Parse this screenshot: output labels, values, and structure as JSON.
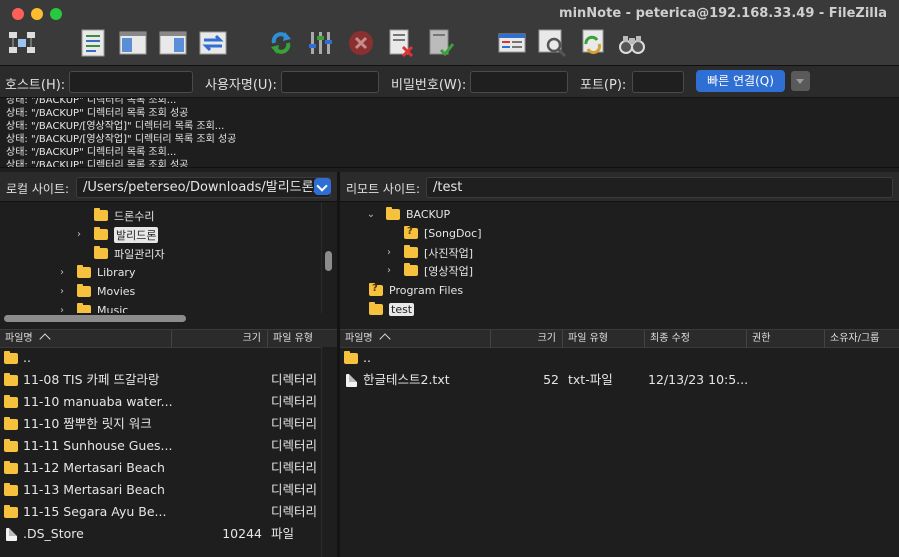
{
  "window": {
    "title": "minNote - peterica@192.168.33.49 - FileZilla"
  },
  "toolbar": {
    "icons": [
      "site-manager-icon",
      "toggle-log-icon",
      "toggle-local-tree-icon",
      "toggle-remote-tree-icon",
      "transfer-queue-icon",
      "refresh-icon",
      "process-queue-icon",
      "cancel-icon",
      "disconnect-icon",
      "reconnect-icon",
      "filter-icon",
      "search-remote-icon",
      "sync-browse-icon",
      "find-files-icon"
    ]
  },
  "quickconnect": {
    "host_label": "호스트(H):",
    "user_label": "사용자명(U):",
    "pass_label": "비밀번호(W):",
    "port_label": "포트(P):",
    "connect_label": "빠른 연결(Q)",
    "host_value": "",
    "user_value": "",
    "pass_value": "",
    "port_value": ""
  },
  "log": [
    "상태:  \"/BACKUP\" 디렉터리 목록 조회...",
    "상태:  \"/BACKUP\" 디렉터리 목록 조회 성공",
    "상태:  \"/BACKUP/[영상작업]\" 디렉터리 목록 조회...",
    "상태:  \"/BACKUP/[영상작업]\" 디렉터리 목록 조회 성공",
    "상태:  \"/BACKUP\" 디렉터리 목록 조회...",
    "상태:  \"/BACKUP\" 디렉터리 목록 조회 성공"
  ],
  "local": {
    "label": "로컬 사이트:",
    "path": "/Users/peterseo/Downloads/발리드론/",
    "tree": [
      {
        "label": "드론수리",
        "chevron": "",
        "selected": false
      },
      {
        "label": "발리드론",
        "chevron": "›",
        "selected": true
      },
      {
        "label": "파일관리자",
        "chevron": "",
        "selected": false
      },
      {
        "label": "Library",
        "chevron": "›",
        "selected": false
      },
      {
        "label": "Movies",
        "chevron": "›",
        "selected": false
      },
      {
        "label": "Music",
        "chevron": "›",
        "selected": false
      }
    ],
    "columns": {
      "name": "파일명",
      "size": "크기",
      "type": "파일 유형"
    },
    "files": [
      {
        "name": "..",
        "size": "",
        "type": "",
        "icon": "folder"
      },
      {
        "name": "11-08 TIS 카페 뜨갈라랑",
        "size": "",
        "type": "디렉터리",
        "icon": "folder"
      },
      {
        "name": "11-10 manuaba water...",
        "size": "",
        "type": "디렉터리",
        "icon": "folder"
      },
      {
        "name": "11-10 짬뿌한 릿지 워크",
        "size": "",
        "type": "디렉터리",
        "icon": "folder"
      },
      {
        "name": "11-11 Sunhouse Gues...",
        "size": "",
        "type": "디렉터리",
        "icon": "folder"
      },
      {
        "name": "11-12 Mertasari Beach",
        "size": "",
        "type": "디렉터리",
        "icon": "folder"
      },
      {
        "name": "11-13 Mertasari Beach",
        "size": "",
        "type": "디렉터리",
        "icon": "folder"
      },
      {
        "name": "11-15 Segara Ayu Be...",
        "size": "",
        "type": "디렉터리",
        "icon": "folder"
      },
      {
        "name": ".DS_Store",
        "size": "10244",
        "type": "파일",
        "icon": "file"
      }
    ]
  },
  "remote": {
    "label": "리모트 사이트:",
    "path": "/test",
    "tree": [
      {
        "label": "BACKUP",
        "chevron": "⌄",
        "selected": false,
        "q": false
      },
      {
        "label": "[SongDoc]",
        "chevron": "",
        "selected": false,
        "q": true
      },
      {
        "label": "[사진작업]",
        "chevron": "›",
        "selected": false,
        "q": false
      },
      {
        "label": "[영상작업]",
        "chevron": "›",
        "selected": false,
        "q": false
      },
      {
        "label": "Program Files",
        "chevron": "",
        "selected": false,
        "q": true
      },
      {
        "label": "test",
        "chevron": "",
        "selected": true,
        "q": false
      },
      {
        "label": "",
        "chevron": "",
        "selected": false,
        "q": false
      }
    ],
    "columns": {
      "name": "파일명",
      "size": "크기",
      "type": "파일 유형",
      "modified": "최종 수정",
      "perms": "권한",
      "owner": "소유자/그룹"
    },
    "files": [
      {
        "name": "..",
        "size": "",
        "type": "",
        "modified": "",
        "icon": "folder"
      },
      {
        "name": "한글테스트2.txt",
        "size": "52",
        "type": "txt-파일",
        "modified": "12/13/23 10:5...",
        "icon": "file"
      }
    ]
  }
}
